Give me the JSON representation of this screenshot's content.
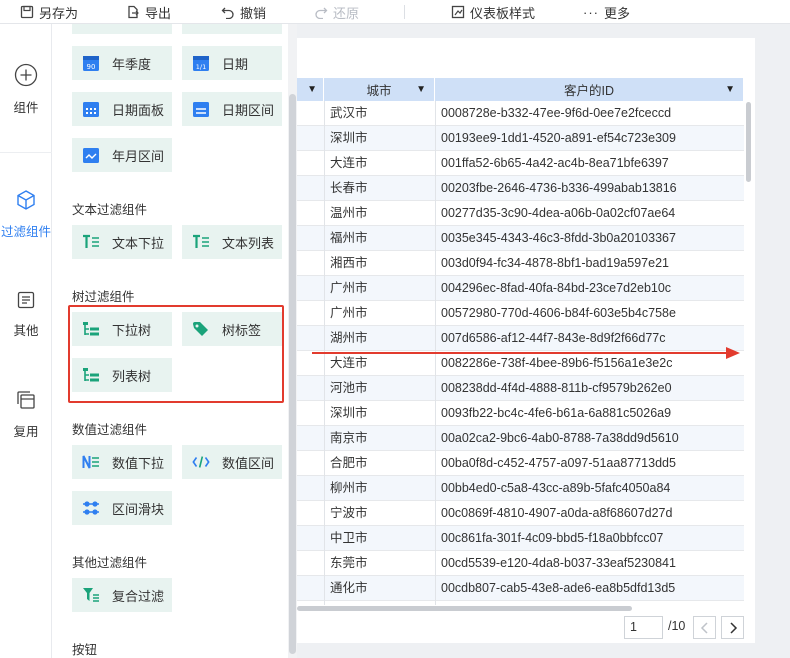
{
  "toolbar": {
    "save_as": "另存为",
    "export": "导出",
    "undo": "撤销",
    "redo": "还原",
    "dashboard_style": "仪表板样式",
    "more": "更多"
  },
  "rail": {
    "components": "组件",
    "filter_components": "过滤组件",
    "other": "其他",
    "reuse": "复用"
  },
  "panel": {
    "date_cards": [
      "年季度",
      "日期",
      "日期面板",
      "日期区间",
      "年月区间"
    ],
    "text_section": "文本过滤组件",
    "text_cards": [
      "文本下拉",
      "文本列表"
    ],
    "tree_section": "树过滤组件",
    "tree_cards": [
      "下拉树",
      "树标签",
      "列表树"
    ],
    "number_section": "数值过滤组件",
    "number_cards": [
      "数值下拉",
      "数值区间",
      "区间滑块"
    ],
    "other_section": "其他过滤组件",
    "other_cards": [
      "复合过滤"
    ],
    "button_section": "按钮",
    "year_quarter_icon_text": "90",
    "date_icon_text": "1/1"
  },
  "table": {
    "columns": [
      "",
      "城市",
      "客户的ID"
    ],
    "rows": [
      [
        "武汉市",
        "0008728e-b332-47ee-9f6d-0ee7e2fceccd"
      ],
      [
        "深圳市",
        "00193ee9-1dd1-4520-a891-ef54c723e309"
      ],
      [
        "大连市",
        "001ffa52-6b65-4a42-ac4b-8ea71bfe6397"
      ],
      [
        "长春市",
        "00203fbe-2646-4736-b336-499abab13816"
      ],
      [
        "温州市",
        "00277d35-3c90-4dea-a06b-0a02cf07ae64"
      ],
      [
        "福州市",
        "0035e345-4343-46c3-8fdd-3b0a20103367"
      ],
      [
        "湘西市",
        "003d0f94-fc34-4878-8bf1-bad19a597e21"
      ],
      [
        "广州市",
        "004296ec-8fad-40fa-84bd-23ce7d2eb10c"
      ],
      [
        "广州市",
        "00572980-770d-4606-b84f-603e5b4c758e"
      ],
      [
        "湖州市",
        "007d6586-af12-44f7-843e-8d9f2f66d77c"
      ],
      [
        "大连市",
        "0082286e-738f-4bee-89b6-f5156a1e3e2c"
      ],
      [
        "河池市",
        "008238dd-4f4d-4888-811b-cf9579b262e0"
      ],
      [
        "深圳市",
        "0093fb22-bc4c-4fe6-b61a-6a881c5026a9"
      ],
      [
        "南京市",
        "00a02ca2-9bc6-4ab0-8788-7a38dd9d5610"
      ],
      [
        "合肥市",
        "00ba0f8d-c452-4757-a097-51aa87713dd5"
      ],
      [
        "柳州市",
        "00bb4ed0-c5a8-43cc-a89b-5fafc4050a84"
      ],
      [
        "宁波市",
        "00c0869f-4810-4907-a0da-a8f68607d27d"
      ],
      [
        "中卫市",
        "00c861fa-301f-4c09-bbd5-f18a0bbfcc07"
      ],
      [
        "东莞市",
        "00cd5539-e120-4da8-b037-33eaf5230841"
      ],
      [
        "通化市",
        "00cdb807-cab5-43e8-ade6-ea8b5dfd13d5"
      ]
    ]
  },
  "pager": {
    "current": "1",
    "total": "/10"
  },
  "colors": {
    "accent": "#2f7ff0",
    "card_bg": "#e8f3f0",
    "icon_green": "#1aa37a",
    "header_bg": "#cfe0f7",
    "highlight_border": "#e23b2e",
    "arrow_red": "#e23b2e"
  }
}
